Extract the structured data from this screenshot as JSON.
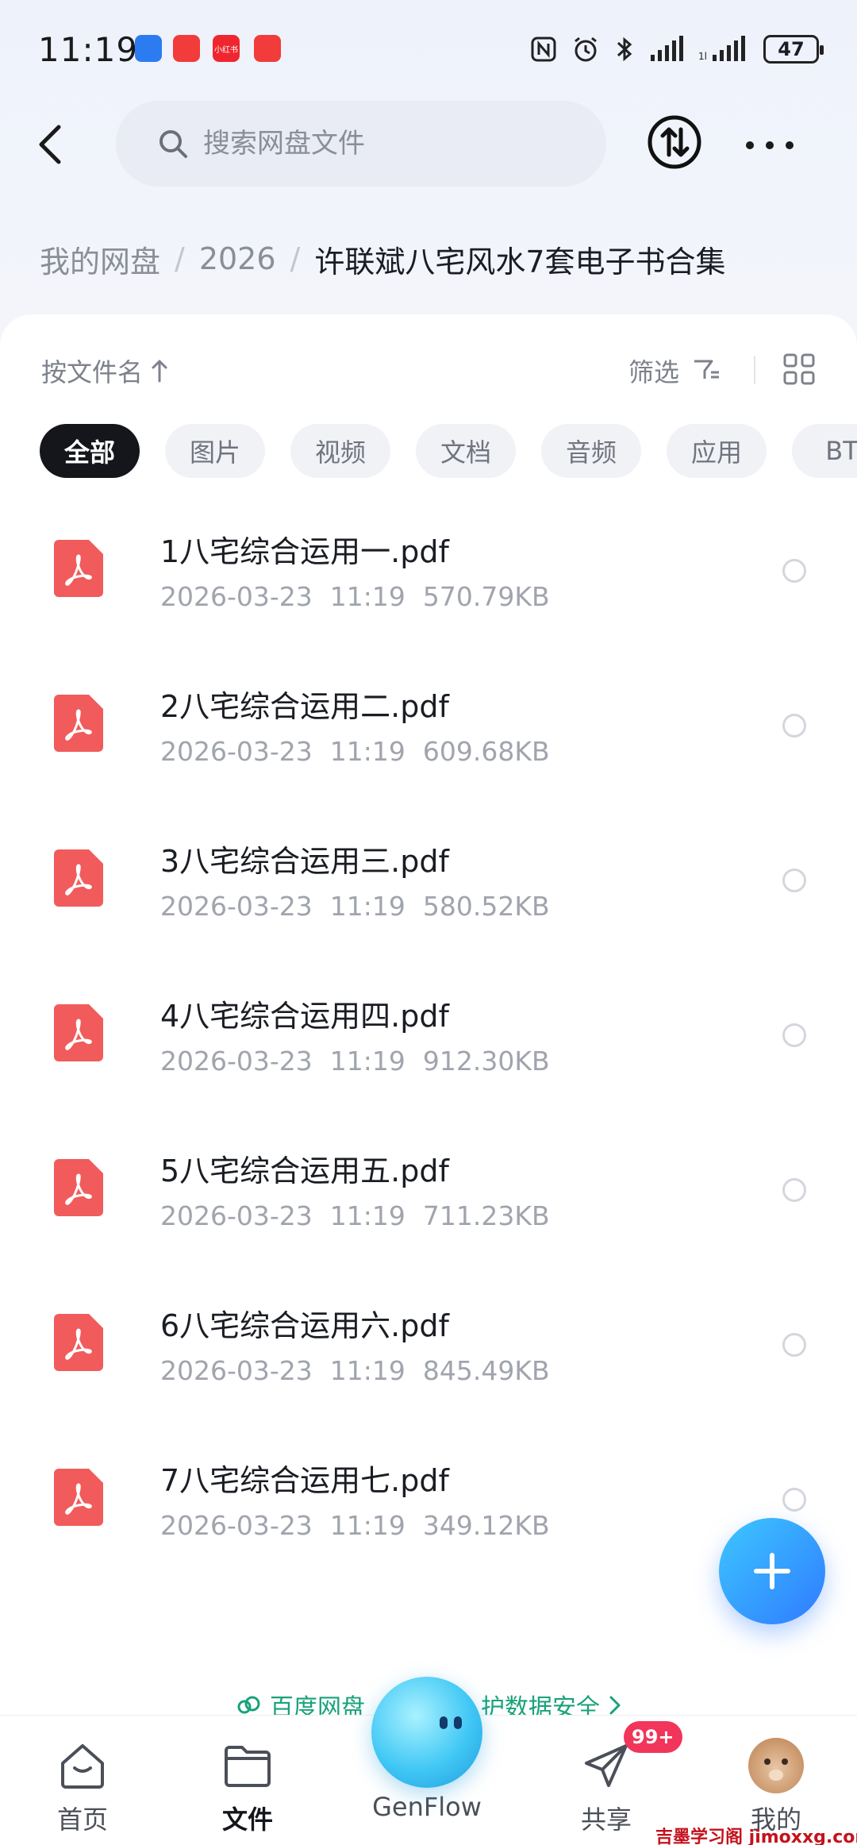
{
  "status_bar": {
    "time": "11:19",
    "apps": [
      {
        "name": "app-icon-blue",
        "color": "#2d7bf0"
      },
      {
        "name": "app-icon-red",
        "color": "#f23b3b"
      },
      {
        "name": "xiaohongshu-icon",
        "color": "#f0262f",
        "label": "小红书"
      },
      {
        "name": "app-icon-red-2",
        "color": "#f23b3b"
      }
    ],
    "battery": "47"
  },
  "header": {
    "search_placeholder": "搜索网盘文件"
  },
  "breadcrumb": {
    "items": [
      "我的网盘",
      "2026"
    ],
    "current": "许联斌八宅风水7套电子书合集"
  },
  "toolbar": {
    "sort_label": "按文件名",
    "filter_label": "筛选"
  },
  "categories": [
    {
      "label": "全部",
      "active": true
    },
    {
      "label": "图片",
      "active": false
    },
    {
      "label": "视频",
      "active": false
    },
    {
      "label": "文档",
      "active": false
    },
    {
      "label": "音频",
      "active": false
    },
    {
      "label": "应用",
      "active": false
    },
    {
      "label": "BT",
      "active": false
    }
  ],
  "files": [
    {
      "name": "1八宅综合运用一.pdf",
      "date": "2026-03-23",
      "time": "11:19",
      "size": "570.79KB"
    },
    {
      "name": "2八宅综合运用二.pdf",
      "date": "2026-03-23",
      "time": "11:19",
      "size": "609.68KB"
    },
    {
      "name": "3八宅综合运用三.pdf",
      "date": "2026-03-23",
      "time": "11:19",
      "size": "580.52KB"
    },
    {
      "name": "4八宅综合运用四.pdf",
      "date": "2026-03-23",
      "time": "11:19",
      "size": "912.30KB"
    },
    {
      "name": "5八宅综合运用五.pdf",
      "date": "2026-03-23",
      "time": "11:19",
      "size": "711.23KB"
    },
    {
      "name": "6八宅综合运用六.pdf",
      "date": "2026-03-23",
      "time": "11:19",
      "size": "845.49KB"
    },
    {
      "name": "7八宅综合运用七.pdf",
      "date": "2026-03-23",
      "time": "11:19",
      "size": "349.12KB"
    }
  ],
  "banner": {
    "left_text": "百度网盘",
    "right_text": "护数据安全",
    "color": "#19a27a"
  },
  "bottom_nav": {
    "items": [
      {
        "label": "首页",
        "icon": "home-icon",
        "active": false
      },
      {
        "label": "文件",
        "icon": "folder-icon",
        "active": true
      },
      {
        "label": "GenFlow",
        "icon": "genflow-orb",
        "active": false
      },
      {
        "label": "共享",
        "icon": "share-icon",
        "active": false
      },
      {
        "label": "我的",
        "icon": "avatar",
        "active": false
      }
    ],
    "share_badge": "99+"
  },
  "watermark": {
    "text": "吉墨学习阁 jimoxxg.com"
  },
  "colors": {
    "pdf_red": "#f15b5b",
    "accent_blue": "#2f7bff",
    "chip_active": "#14161b"
  }
}
